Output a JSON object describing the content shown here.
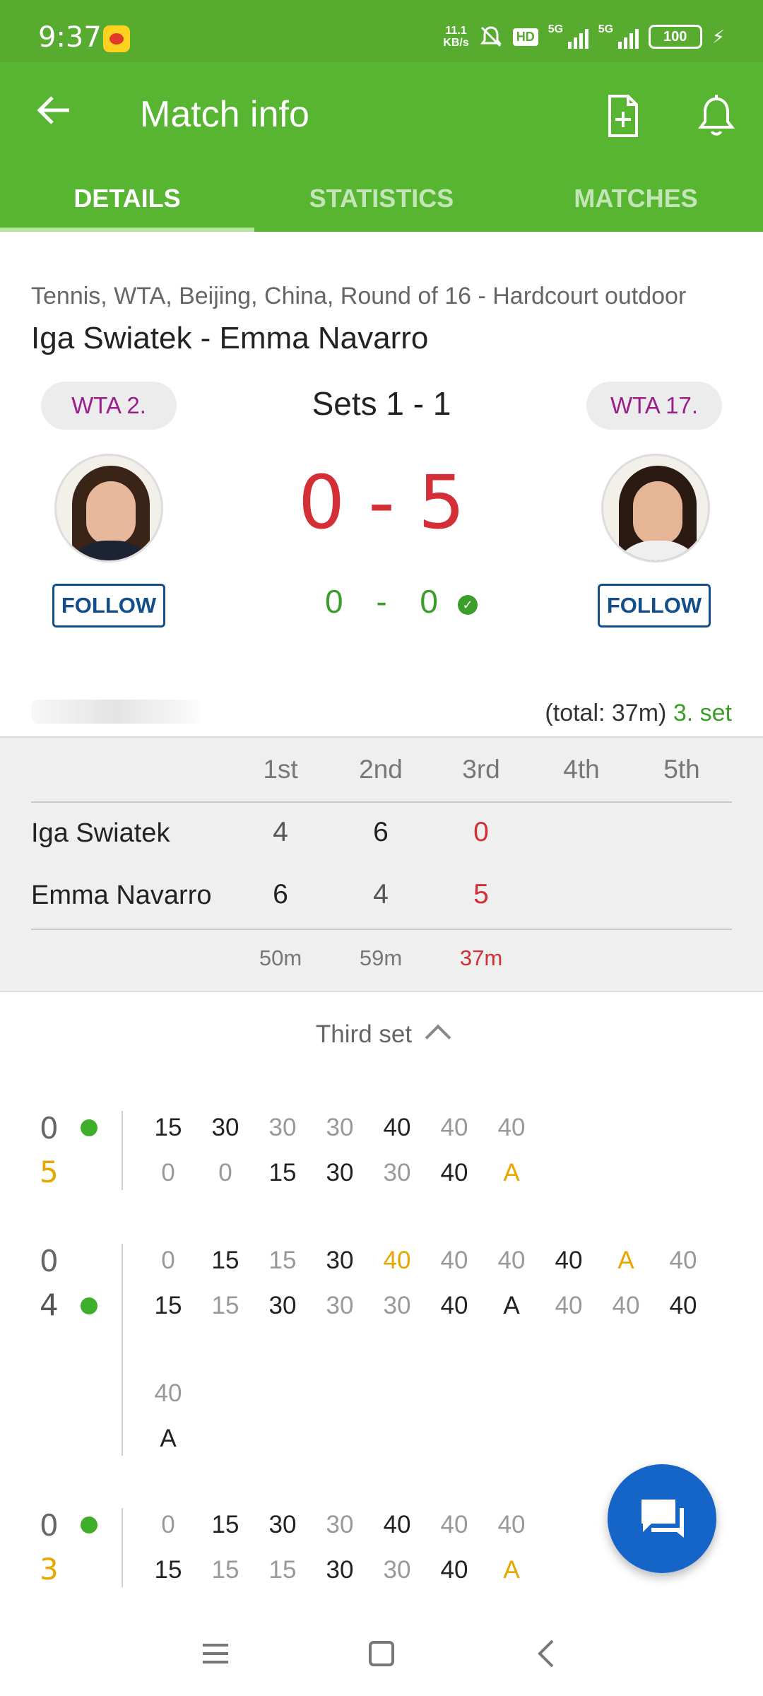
{
  "status": {
    "time": "9:37",
    "speed_top": "11.1",
    "speed_bottom": "KB/s",
    "hd": "HD",
    "net1": "5G",
    "net2": "5G",
    "battery": "100"
  },
  "header": {
    "title": "Match info"
  },
  "tabs": [
    {
      "label": "DETAILS"
    },
    {
      "label": "STATISTICS"
    },
    {
      "label": "MATCHES"
    }
  ],
  "match": {
    "meta": "Tennis, WTA, Beijing, China, Round of 16 - Hardcourt outdoor",
    "title": "Iga Swiatek - Emma Navarro",
    "sets": "Sets 1 - 1",
    "score": "0 - 5",
    "game_home": "0",
    "game_sep": "-",
    "game_away": "0",
    "home_rank": "WTA 2.",
    "away_rank": "WTA 17.",
    "follow_label": "FOLLOW",
    "total": "(total: 37m)",
    "current_set": "3. set"
  },
  "scoreboard": {
    "headers": [
      "1st",
      "2nd",
      "3rd",
      "4th",
      "5th"
    ],
    "players": [
      {
        "name": "Iga Swiatek",
        "sets": [
          "4",
          "6",
          "0"
        ]
      },
      {
        "name": "Emma Navarro",
        "sets": [
          "6",
          "4",
          "5"
        ]
      }
    ],
    "durations": [
      "50m",
      "59m",
      "37m"
    ]
  },
  "section": {
    "label": "Third set"
  },
  "games": [
    {
      "top_score": "0",
      "bottom_score": "5",
      "top_row": [
        "15",
        "30",
        "30",
        "30",
        "40",
        "40",
        "40"
      ],
      "bottom_row": [
        "0",
        "0",
        "15",
        "30",
        "30",
        "40",
        "A"
      ]
    },
    {
      "top_score": "0",
      "bottom_score": "4",
      "top_row": [
        "0",
        "15",
        "15",
        "30",
        "40",
        "40",
        "40",
        "40",
        "A",
        "40"
      ],
      "bottom_row": [
        "15",
        "15",
        "30",
        "30",
        "30",
        "40",
        "A",
        "40",
        "40",
        "40"
      ],
      "extra_top": "40",
      "extra_bottom": "A"
    },
    {
      "top_score": "0",
      "bottom_score": "3",
      "top_row": [
        "0",
        "15",
        "30",
        "30",
        "40",
        "40",
        "40"
      ],
      "bottom_row": [
        "15",
        "15",
        "15",
        "30",
        "30",
        "40",
        "A"
      ]
    }
  ],
  "colors": {
    "brand_green": "#57b531",
    "score_red": "#d42f36",
    "game_orange": "#e7a700",
    "follow_blue": "#124f8a",
    "fab_blue": "#1565c8"
  }
}
